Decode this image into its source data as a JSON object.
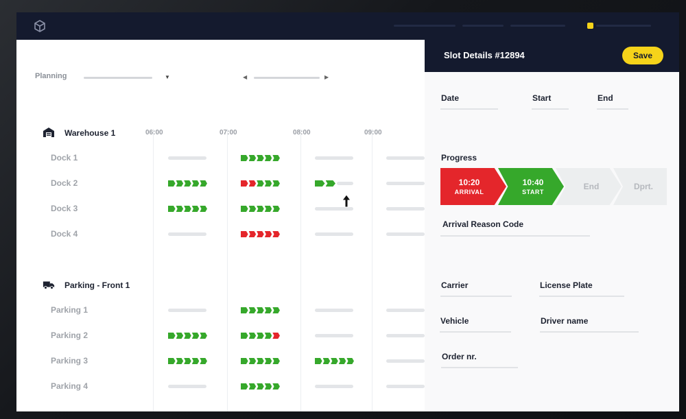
{
  "colors": {
    "accent": "#f5d31a",
    "green": "#36a82b",
    "red": "#e4262b",
    "navy": "#141a2e"
  },
  "header": {
    "logo_icon": "cube-icon"
  },
  "toolbar": {
    "planning_label": "Planning"
  },
  "times": [
    "06:00",
    "07:00",
    "08:00",
    "09:00"
  ],
  "groups": [
    {
      "title": "Warehouse 1",
      "icon": "warehouse-icon",
      "rows": [
        {
          "label": "Dock 1",
          "slots": [
            "empty",
            "ggggg",
            "empty",
            "empty"
          ]
        },
        {
          "label": "Dock 2",
          "slots": [
            "ggggg",
            "rrggg",
            "g",
            "empty"
          ]
        },
        {
          "label": "Dock 3",
          "slots": [
            "ggggg",
            "ggggg",
            "empty",
            "empty"
          ]
        },
        {
          "label": "Dock 4",
          "slots": [
            "empty",
            "rrrrr",
            "empty",
            "empty"
          ]
        }
      ]
    },
    {
      "title": "Parking - Front 1",
      "icon": "truck-icon",
      "rows": [
        {
          "label": "Parking 1",
          "slots": [
            "empty",
            "ggggg",
            "empty",
            "empty"
          ]
        },
        {
          "label": "Parking 2",
          "slots": [
            "ggggg",
            "ggggr",
            "empty",
            "empty"
          ]
        },
        {
          "label": "Parking 3",
          "slots": [
            "ggggg",
            "ggggg",
            "ggggg",
            "empty"
          ]
        },
        {
          "label": "Parking 4",
          "slots": [
            "empty",
            "ggggg",
            "empty",
            "empty"
          ]
        }
      ]
    }
  ],
  "panel": {
    "title": "Slot Details #12894",
    "save_label": "Save",
    "fields": {
      "date": "Date",
      "start": "Start",
      "end": "End",
      "progress": "Progress",
      "arrival_reason": "Arrival Reason Code",
      "carrier": "Carrier",
      "license_plate": "License Plate",
      "vehicle": "Vehicle",
      "driver_name": "Driver name",
      "order_nr": "Order nr."
    },
    "progress_steps": {
      "arrival": {
        "time": "10:20",
        "label": "ARRIVAL"
      },
      "start": {
        "time": "10:40",
        "label": "START"
      },
      "end": {
        "label": "End"
      },
      "dprt": {
        "label": "Dprt."
      }
    }
  }
}
